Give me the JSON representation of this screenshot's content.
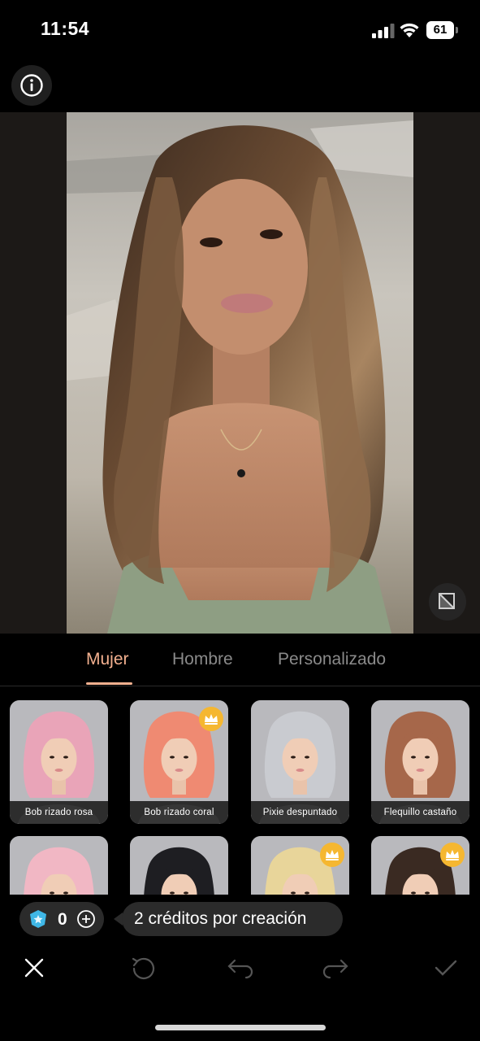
{
  "status_bar": {
    "time": "11:54",
    "battery": "61"
  },
  "header": {
    "info_icon": "info-icon"
  },
  "photo": {
    "compare_icon": "compare-icon"
  },
  "tabs": [
    {
      "label": "Mujer",
      "active": true
    },
    {
      "label": "Hombre",
      "active": false
    },
    {
      "label": "Personalizado",
      "active": false
    }
  ],
  "styles": [
    {
      "label": "Bob rizado rosa",
      "premium": false,
      "hair_color": "#e9a4b8"
    },
    {
      "label": "Bob rizado coral",
      "premium": true,
      "hair_color": "#ef8a72"
    },
    {
      "label": "Pixie despuntado",
      "premium": false,
      "hair_color": "#c9cbd0"
    },
    {
      "label": "Flequillo castaño",
      "premium": false,
      "hair_color": "#a6674a"
    },
    {
      "label": "",
      "premium": false,
      "hair_color": "#f1b7c4"
    },
    {
      "label": "",
      "premium": false,
      "hair_color": "#1e1e22"
    },
    {
      "label": "",
      "premium": true,
      "hair_color": "#e8d59a"
    },
    {
      "label": "",
      "premium": true,
      "hair_color": "#3a2a22"
    }
  ],
  "credits": {
    "count": "0",
    "tooltip": "2 créditos por creación"
  },
  "toolbar": [
    "close-icon",
    "reset-icon",
    "undo-icon",
    "redo-icon",
    "confirm-icon"
  ],
  "colors": {
    "accent": "#f3b08f",
    "crown": "#f5b731",
    "background": "#000000"
  }
}
